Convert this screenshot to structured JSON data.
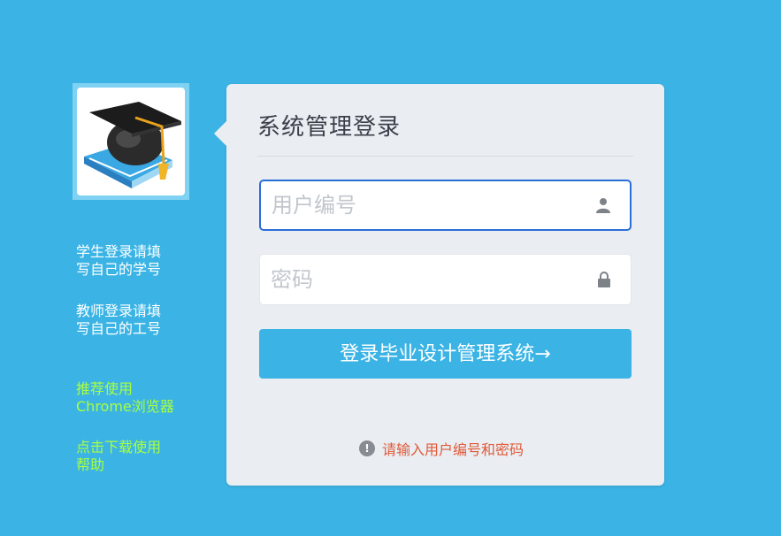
{
  "sidebar": {
    "logo_icon": "graduation-cap-book-icon",
    "student_note_line1": "学生登录请填",
    "student_note_line2": "写自己的学号",
    "teacher_note_line1": "教师登录请填",
    "teacher_note_line2": "写自己的工号",
    "browser_tip_line1": "推荐使用",
    "browser_tip_line2": "Chrome浏览器",
    "help_link_line1": "点击下载使用",
    "help_link_line2": "帮助"
  },
  "login": {
    "title": "系统管理登录",
    "username_placeholder": "用户编号",
    "username_icon": "user-icon",
    "password_placeholder": "密码",
    "password_icon": "lock-icon",
    "submit_label": "登录毕业设计管理系统→",
    "hint_text": "请输入用户编号和密码"
  },
  "colors": {
    "background": "#3bb4e5",
    "panel": "#eaedf1",
    "button": "#3bb4e5",
    "link": "#a8ff3e",
    "hint": "#e05a3a",
    "focus_border": "#2a6ed8"
  }
}
